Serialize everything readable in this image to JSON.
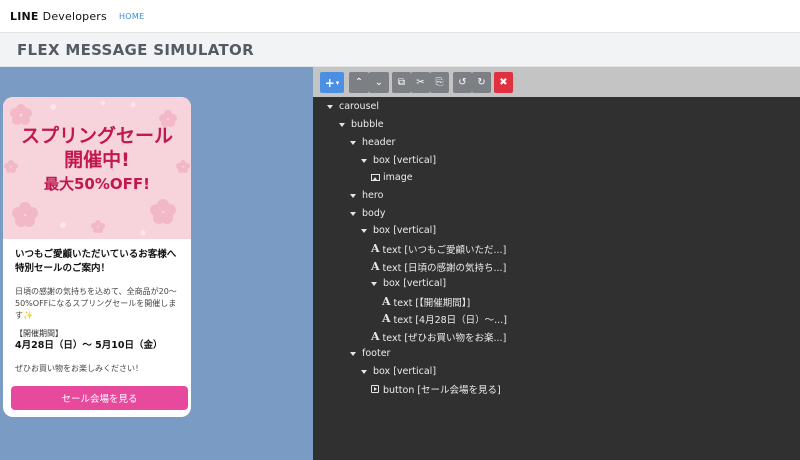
{
  "nav": {
    "logo_main": "LINE",
    "logo_sub": "Developers",
    "home_link": "HOME"
  },
  "page": {
    "title": "FLEX MESSAGE SIMULATOR"
  },
  "preview": {
    "hero": {
      "line1": "スプリングセール",
      "line2": "開催中!",
      "line3": "最大50%OFF!"
    },
    "body": {
      "title": "いつもご愛顧いただいているお客様へ特別セールのご案内！",
      "desc": "日頃の感謝の気持ちを込めて、全商品が20〜50%OFFになるスプリングセールを開催します",
      "sparkle": "✨",
      "period_label": "【開催期間】",
      "period": "4月28日（日）〜 5月10日（金）",
      "note": "ぜひお買い物をお楽しみください！"
    },
    "button_label": "セール会場を見る",
    "colors": {
      "hero_bg": "#f7d4dc",
      "hero_text": "#c2174f",
      "button": "#e74a9d",
      "background": "#7a9cc4"
    }
  },
  "toolbar": {
    "add": "+",
    "add_caret": "▾",
    "up": "⌃",
    "down": "⌄",
    "copy": "⧉",
    "cut": "✂",
    "paste": "⎘",
    "undo": "↺",
    "redo": "↻",
    "delete": "✖"
  },
  "tree": {
    "carousel": "carousel",
    "bubble": "bubble",
    "header": "header",
    "header_box": "box [vertical]",
    "header_image": "image",
    "hero": "hero",
    "body": "body",
    "body_box": "box [vertical]",
    "text1": "text [いつもご愛顧いただ...]",
    "text2": "text [日頃の感謝の気持ち...]",
    "inner_box": "box [vertical]",
    "text3": "text [【開催期間】]",
    "text4": "text [4月28日（日）〜...]",
    "text5": "text [ぜひお買い物をお楽...]",
    "footer": "footer",
    "footer_box": "box [vertical]",
    "button": "button [セール会場を見る]",
    "text_icon": "A"
  }
}
